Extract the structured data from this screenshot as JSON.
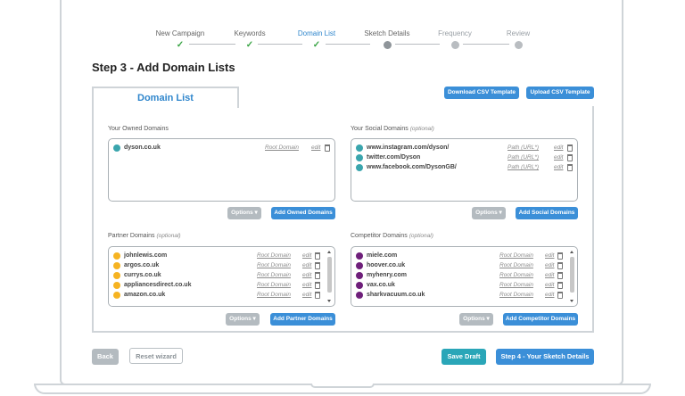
{
  "stepper": [
    {
      "label": "New Campaign",
      "state": "done"
    },
    {
      "label": "Keywords",
      "state": "done"
    },
    {
      "label": "Domain List",
      "state": "active"
    },
    {
      "label": "Sketch Details",
      "state": "pending"
    },
    {
      "label": "Frequency",
      "state": "pending"
    },
    {
      "label": "Review",
      "state": "pending"
    }
  ],
  "page_title": "Step 3 - Add Domain Lists",
  "tab_label": "Domain List",
  "top_buttons": {
    "download": "Download CSV Template",
    "upload": "Upload CSV Template"
  },
  "owned": {
    "title": "Your Owned Domains",
    "items": [
      {
        "domain": "dyson.co.uk",
        "type": "Root Domain",
        "edit": "edit"
      }
    ],
    "options": "Options",
    "add": "Add Owned Domains"
  },
  "social": {
    "title": "Your Social Domains",
    "optional": "(optional)",
    "items": [
      {
        "domain": "www.instagram.com/dyson/",
        "type": "Path (URL*)",
        "edit": "edit"
      },
      {
        "domain": "twitter.com/Dyson",
        "type": "Path (URL*)",
        "edit": "edit"
      },
      {
        "domain": "www.facebook.com/DysonGB/",
        "type": "Path (URL*)",
        "edit": "edit"
      }
    ],
    "options": "Options",
    "add": "Add Social Domains"
  },
  "partner": {
    "title": "Partner Domains",
    "optional": "(optional)",
    "items": [
      {
        "domain": "johnlewis.com",
        "type": "Root Domain",
        "edit": "edit"
      },
      {
        "domain": "argos.co.uk",
        "type": "Root Domain",
        "edit": "edit"
      },
      {
        "domain": "currys.co.uk",
        "type": "Root Domain",
        "edit": "edit"
      },
      {
        "domain": "appliancesdirect.co.uk",
        "type": "Root Domain",
        "edit": "edit"
      },
      {
        "domain": "amazon.co.uk",
        "type": "Root Domain",
        "edit": "edit"
      }
    ],
    "options": "Options",
    "add": "Add Partner Domains"
  },
  "competitor": {
    "title": "Competitor Domains",
    "optional": "(optional)",
    "items": [
      {
        "domain": "miele.com",
        "type": "Root Domain",
        "edit": "edit"
      },
      {
        "domain": "hoover.co.uk",
        "type": "Root Domain",
        "edit": "edit"
      },
      {
        "domain": "myhenry.com",
        "type": "Root Domain",
        "edit": "edit"
      },
      {
        "domain": "vax.co.uk",
        "type": "Root Domain",
        "edit": "edit"
      },
      {
        "domain": "sharkvacuum.co.uk",
        "type": "Root Domain",
        "edit": "edit"
      }
    ],
    "options": "Options",
    "add": "Add Competitor Domains"
  },
  "footer": {
    "back": "Back",
    "reset": "Reset wizard",
    "save": "Save Draft",
    "next": "Step 4 - Your Sketch Details"
  },
  "colors": {
    "accent": "#3b8fd8",
    "teal": "#2aa6b8",
    "done": "#3aa545",
    "owned_icon": "#3aa5ad",
    "partner_icon": "#f6b321",
    "competitor_icon": "#6e1f7a"
  }
}
